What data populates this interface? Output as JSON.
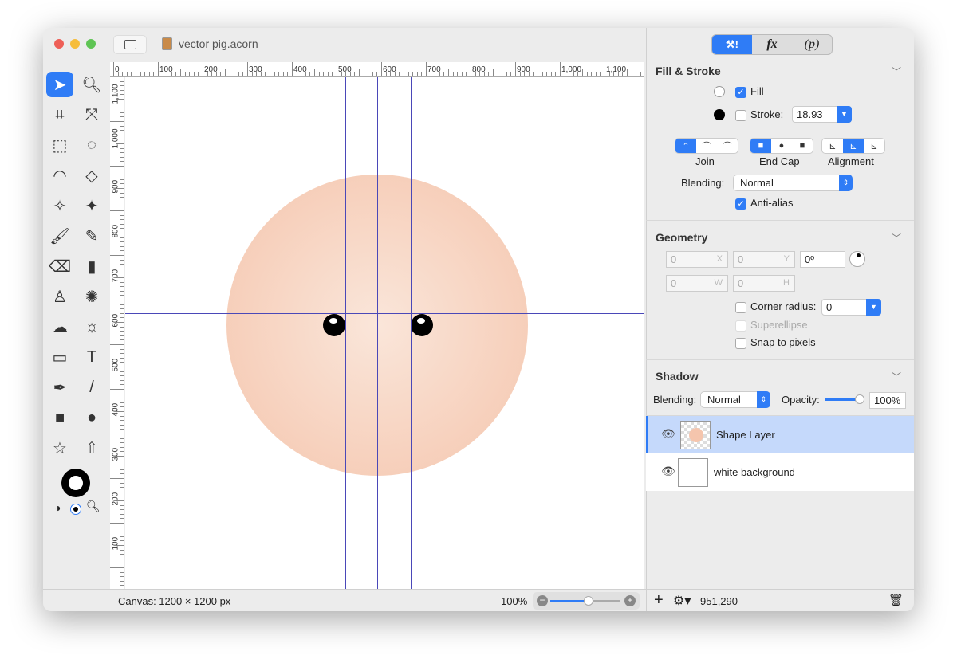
{
  "window": {
    "title": "vector pig.acorn"
  },
  "inspector_tabs": [
    {
      "icon": "tools-icon",
      "active": true
    },
    {
      "label": "fx"
    },
    {
      "label": "(p)"
    }
  ],
  "fill_stroke": {
    "title": "Fill & Stroke",
    "fill_label": "Fill",
    "fill_checked": true,
    "stroke_label": "Stroke:",
    "stroke_checked": false,
    "stroke_width": "18.93",
    "join_label": "Join",
    "endcap_label": "End Cap",
    "alignment_label": "Alignment",
    "blending_label": "Blending:",
    "blending_value": "Normal",
    "antialias_label": "Anti-alias",
    "antialias_checked": true,
    "fill_color": "#ffffff",
    "stroke_color": "#000000"
  },
  "geometry": {
    "title": "Geometry",
    "x": "0",
    "x_suffix": "X",
    "y": "0",
    "y_suffix": "Y",
    "angle": "0º",
    "w": "0",
    "w_suffix": "W",
    "h": "0",
    "h_suffix": "H",
    "corner_radius_label": "Corner radius:",
    "corner_radius": "0",
    "superellipse_label": "Superellipse",
    "snap_label": "Snap to pixels"
  },
  "shadow": {
    "title": "Shadow",
    "blending_label": "Blending:",
    "blending_value": "Normal",
    "opacity_label": "Opacity:",
    "opacity": "100%"
  },
  "layers": [
    {
      "name": "Shape Layer",
      "selected": true
    },
    {
      "name": "white background",
      "selected": false
    }
  ],
  "rulers": {
    "h_labels": [
      "0",
      "100",
      "200",
      "300",
      "400",
      "500",
      "600",
      "700",
      "800",
      "900",
      "1,000",
      "1,100"
    ],
    "v_labels": [
      "1,100",
      "1,000",
      "900",
      "800",
      "700",
      "600",
      "500",
      "400",
      "300",
      "200",
      "100"
    ]
  },
  "status": {
    "canvas": "Canvas: 1200 × 1200 px",
    "zoom": "100%",
    "zoom_fraction": 0.55,
    "coords": "951,290"
  },
  "colors": {
    "accent": "#2f7cf6",
    "pig": "#f5c5ad",
    "guide": "#4a48b8"
  }
}
